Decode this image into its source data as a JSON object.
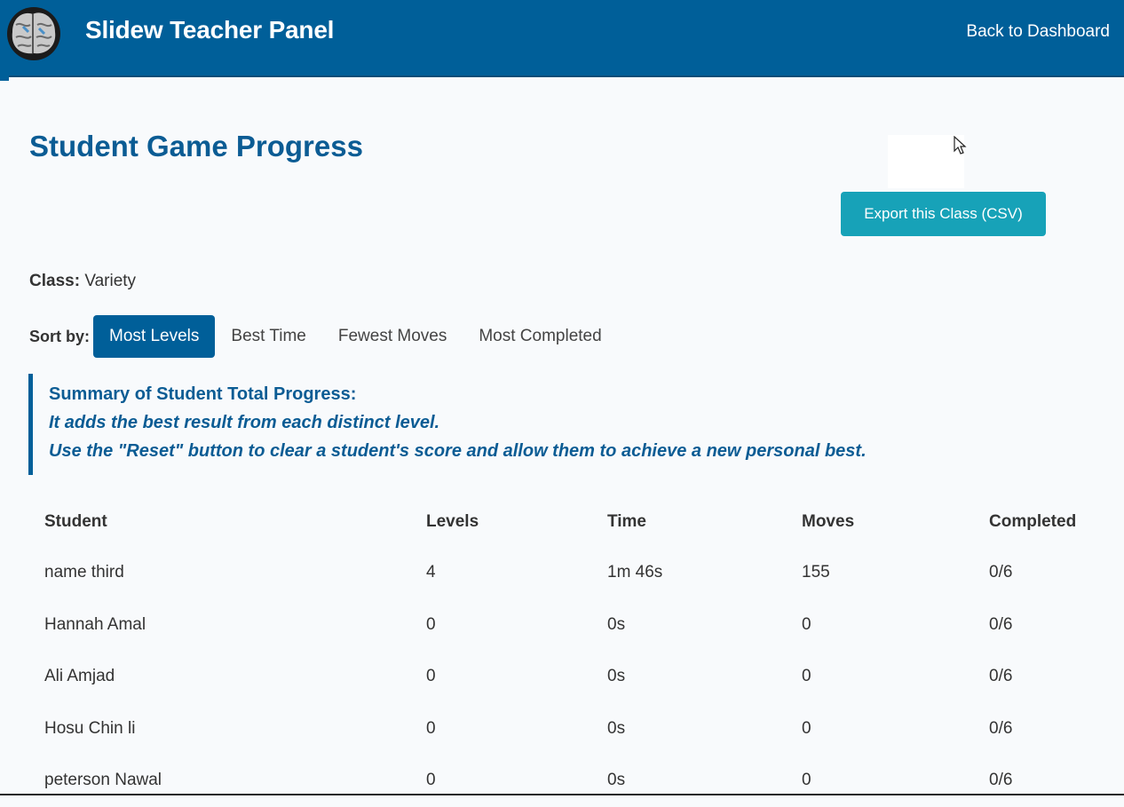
{
  "header": {
    "app_title": "Slidew Teacher Panel",
    "back_link": "Back to Dashboard",
    "bar_color": "#005f99"
  },
  "main": {
    "page_title": "Student Game Progress",
    "export_button": "Export this Class (CSV)",
    "class_label": "Class:",
    "class_name": "Variety",
    "sort_label": "Sort by:",
    "sort_options": [
      "Most Levels",
      "Best Time",
      "Fewest Moves",
      "Most Completed"
    ],
    "active_sort": "Most Levels",
    "summary": {
      "title": "Summary of Student Total Progress:",
      "line1": "It adds the best result from each distinct level.",
      "line2": "Use the \"Reset\" button to clear a student's score and allow them to achieve a new personal best."
    },
    "table": {
      "columns": [
        "Student",
        "Levels",
        "Time",
        "Moves",
        "Completed"
      ],
      "rows": [
        [
          "name third",
          "4",
          "1m 46s",
          "155",
          "0/6"
        ],
        [
          "Hannah Amal",
          "0",
          "0s",
          "0",
          "0/6"
        ],
        [
          "Ali Amjad",
          "0",
          "0s",
          "0",
          "0/6"
        ],
        [
          "Hosu Chin li",
          "0",
          "0s",
          "0",
          "0/6"
        ],
        [
          "peterson Nawal",
          "0",
          "0s",
          "0",
          "0/6"
        ]
      ]
    }
  },
  "colors": {
    "accent": "#005f99",
    "title_blue": "#0b5c94",
    "export_teal": "#17a2b8",
    "page_bg": "#f8fafc"
  },
  "icons": {
    "logo": "brain-logo-icon",
    "cursor": "mouse-pointer-icon"
  }
}
